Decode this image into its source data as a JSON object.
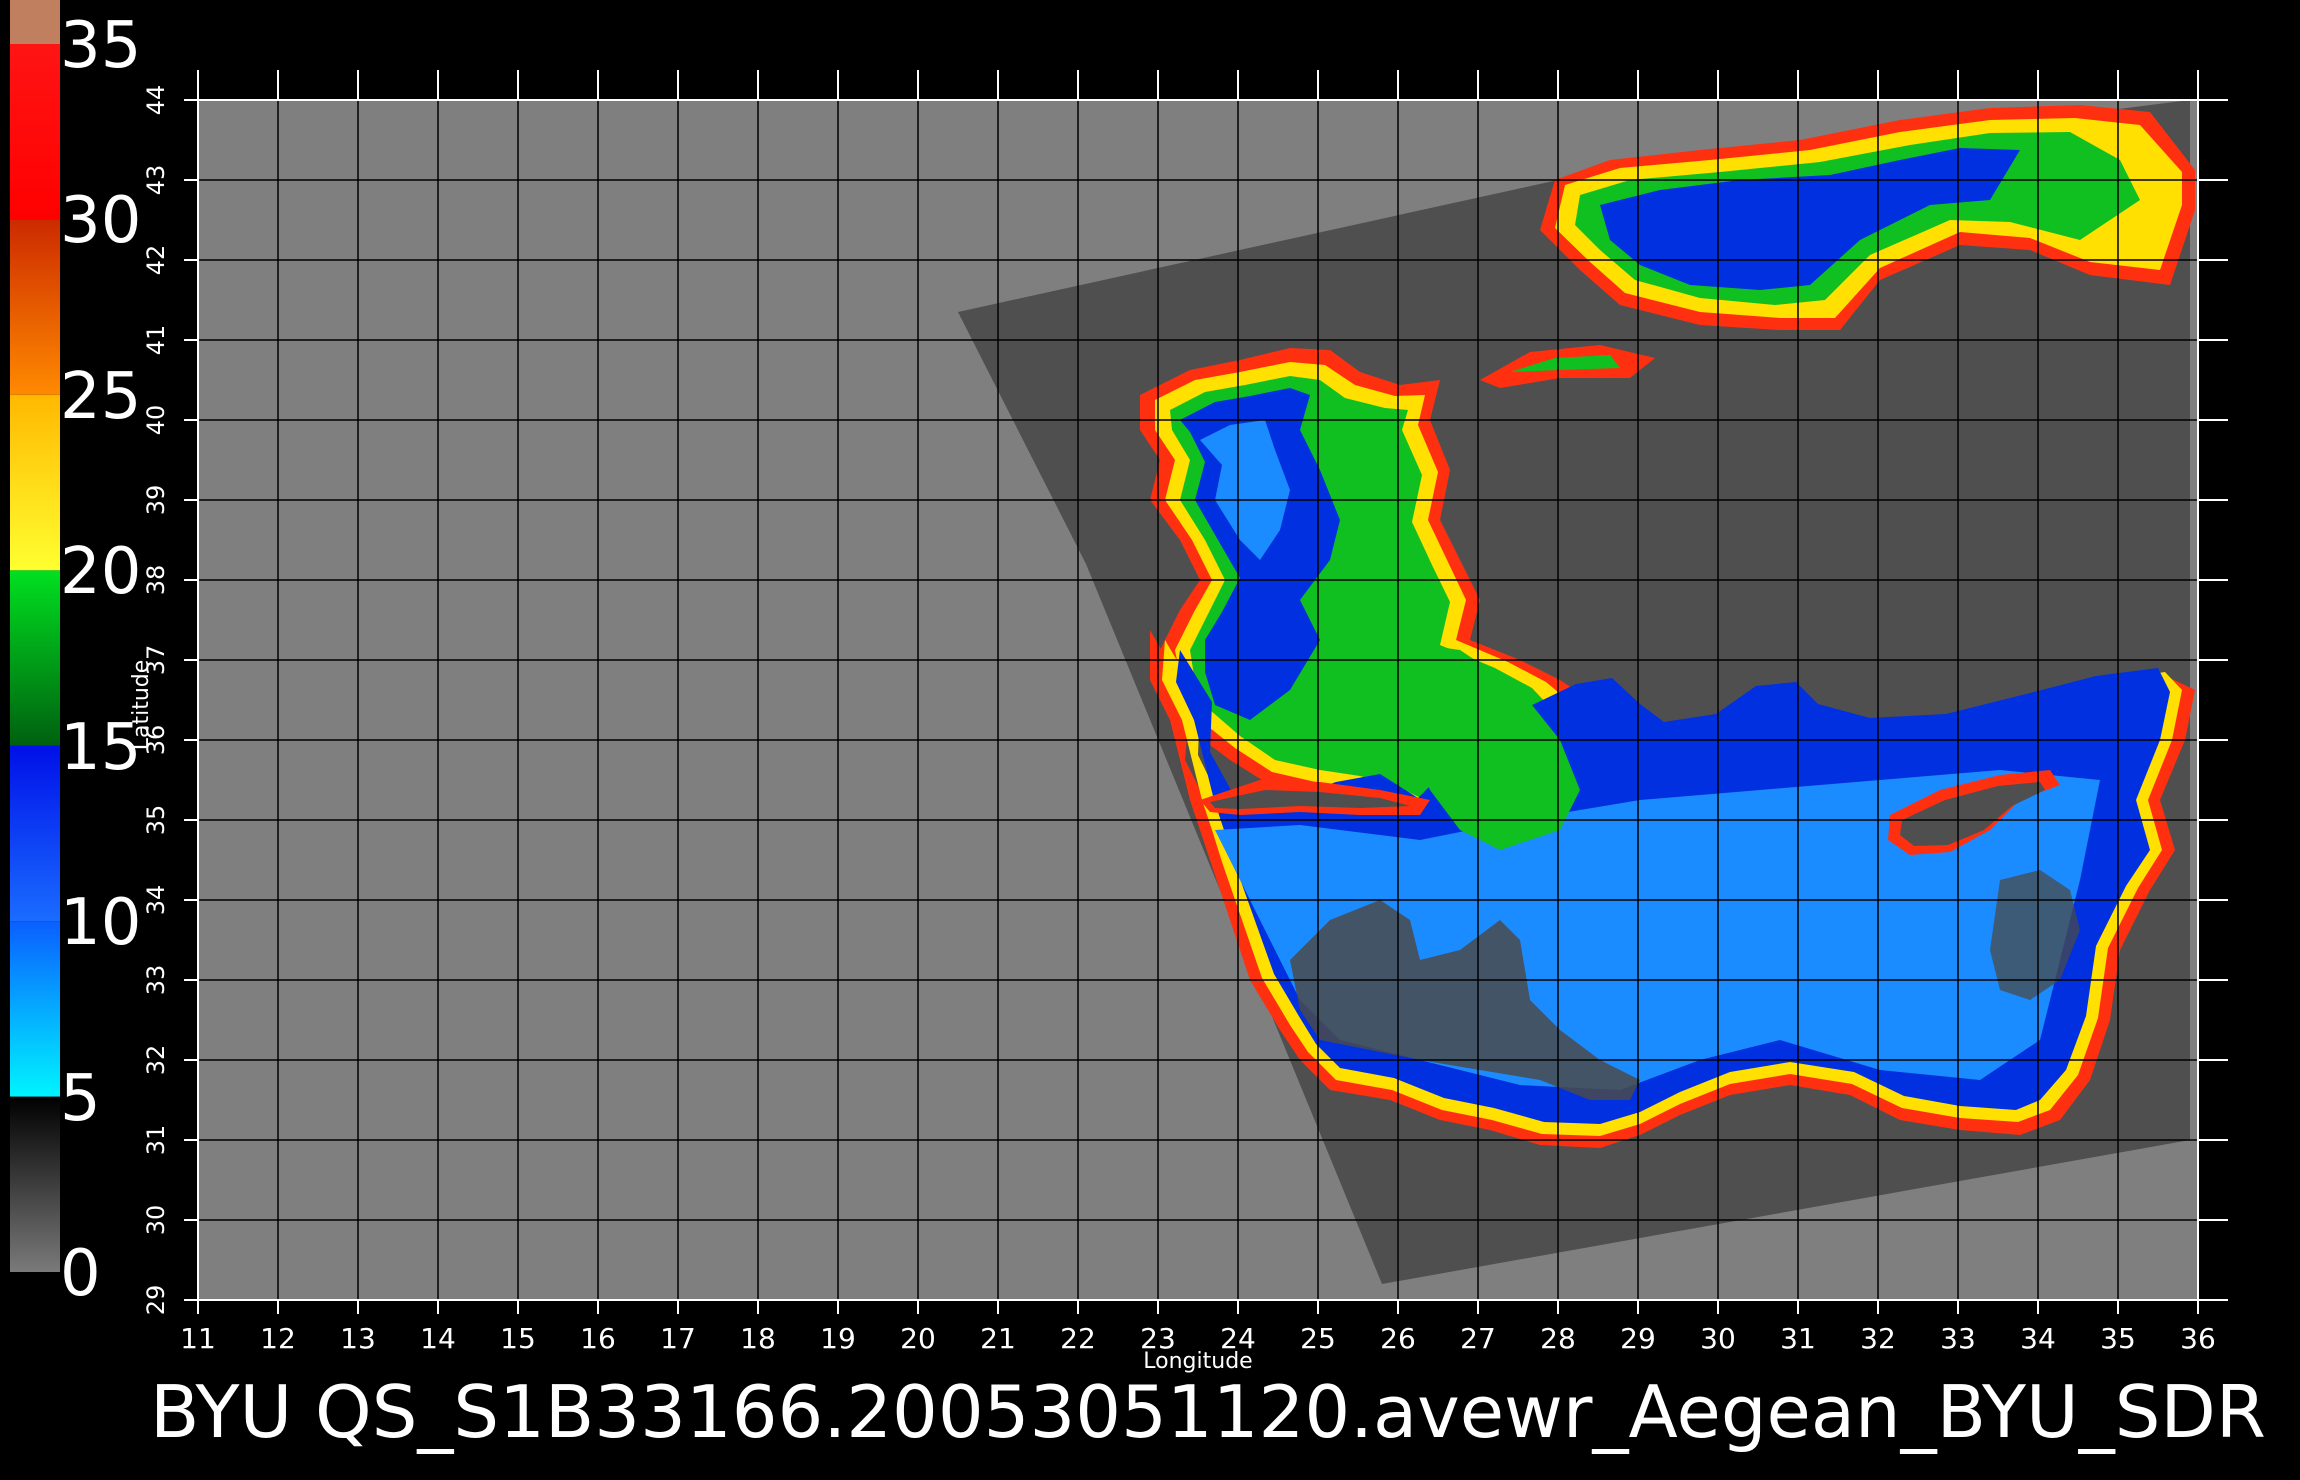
{
  "figure": {
    "title": "BYU  QS_S1B33166.20053051120.avewr_Aegean_BYU_SDR",
    "x_axis_label": "Longitude",
    "y_axis_label": "Latitude",
    "lon_range": [
      11,
      36
    ],
    "lat_range": [
      29,
      44
    ],
    "lon_ticks": [
      "11",
      "12",
      "13",
      "14",
      "15",
      "16",
      "17",
      "18",
      "19",
      "20",
      "21",
      "22",
      "23",
      "24",
      "25",
      "26",
      "27",
      "28",
      "29",
      "30",
      "31",
      "32",
      "33",
      "34",
      "35",
      "36"
    ],
    "lat_ticks": [
      "29",
      "30",
      "31",
      "32",
      "33",
      "34",
      "35",
      "36",
      "37",
      "38",
      "39",
      "40",
      "41",
      "42",
      "43",
      "44"
    ]
  },
  "colorbar": {
    "labels": [
      "35",
      "30",
      "25",
      "20",
      "15",
      "10",
      "5",
      "0"
    ],
    "range": [
      0,
      35
    ],
    "segments": [
      {
        "from": 0,
        "to": 5,
        "color_top": "#000000",
        "color_bottom": "#7a7a7a"
      },
      {
        "from": 5,
        "to": 10,
        "color_top": "#0a5fff",
        "color_bottom": "#00f4ff"
      },
      {
        "from": 10,
        "to": 15,
        "color_top": "#0010e8",
        "color_bottom": "#1a6cff"
      },
      {
        "from": 15,
        "to": 20,
        "color_top": "#00e020",
        "color_bottom": "#006010"
      },
      {
        "from": 20,
        "to": 25,
        "color_top": "#ffb800",
        "color_bottom": "#ffff30"
      },
      {
        "from": 25,
        "to": 30,
        "color_top": "#cc2a00",
        "color_bottom": "#ff8a00"
      },
      {
        "from": 30,
        "to": 35,
        "color_top": "#ff1414",
        "color_bottom": "#ff0000"
      }
    ],
    "cap_color": "#c08060"
  },
  "colors": {
    "background": "#000000",
    "land": "#7f7f7f",
    "swath": "#4f4f4f",
    "grid": "#000000",
    "frame": "#ffffff",
    "low_wind": "#0030e0",
    "mid_wind": "#1a8cff",
    "moderate_wind": "#10c020",
    "high_wind": "#ffe000",
    "very_high_wind": "#ff3010"
  }
}
